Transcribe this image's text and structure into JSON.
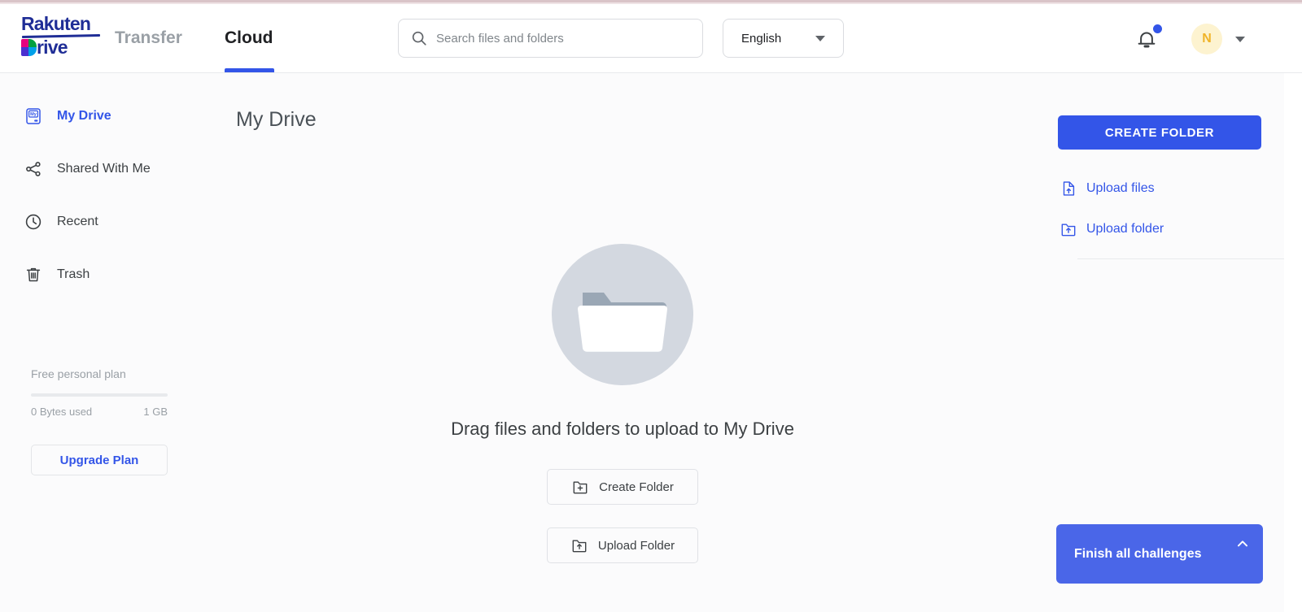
{
  "brand": {
    "logo_top": "Rakuten",
    "logo_bottom": "rive",
    "accent_blue": "#3355e8",
    "logo_navy": "#1f2d96"
  },
  "header": {
    "tabs": [
      {
        "label": "Transfer",
        "active": false
      },
      {
        "label": "Cloud",
        "active": true
      }
    ],
    "search": {
      "placeholder": "Search files and folders",
      "value": "",
      "icon": "search-icon"
    },
    "language": {
      "selected": "English",
      "icon": "chevron-down-icon"
    },
    "notifications": {
      "icon": "bell-icon",
      "has_unread": true
    },
    "account": {
      "initial": "N",
      "icon": "chevron-down-icon"
    }
  },
  "sidebar": {
    "items": [
      {
        "label": "My Drive",
        "icon": "my-drive-icon",
        "active": true
      },
      {
        "label": "Shared With Me",
        "icon": "share-icon",
        "active": false
      },
      {
        "label": "Recent",
        "icon": "clock-icon",
        "active": false
      },
      {
        "label": "Trash",
        "icon": "trash-icon",
        "active": false
      }
    ],
    "storage": {
      "plan_name": "Free personal plan",
      "used_label": "0 Bytes used",
      "total_label": "1 GB",
      "used_percent": 0
    },
    "upgrade_button": "Upgrade Plan"
  },
  "main": {
    "page_title": "My Drive",
    "empty_state": {
      "illustration": "empty-folder-illustration",
      "message": "Drag files and folders to upload to My Drive",
      "buttons": [
        {
          "label": "Create Folder",
          "icon": "folder-plus-icon"
        },
        {
          "label": "Upload Folder",
          "icon": "folder-upload-icon"
        }
      ]
    }
  },
  "right_panel": {
    "create_folder_button": "CREATE FOLDER",
    "links": [
      {
        "label": "Upload files",
        "icon": "file-upload-icon"
      },
      {
        "label": "Upload folder",
        "icon": "folder-upload-icon"
      }
    ]
  },
  "challenges": {
    "label": "Finish all challenges",
    "toggle_icon": "chevron-up-icon"
  }
}
